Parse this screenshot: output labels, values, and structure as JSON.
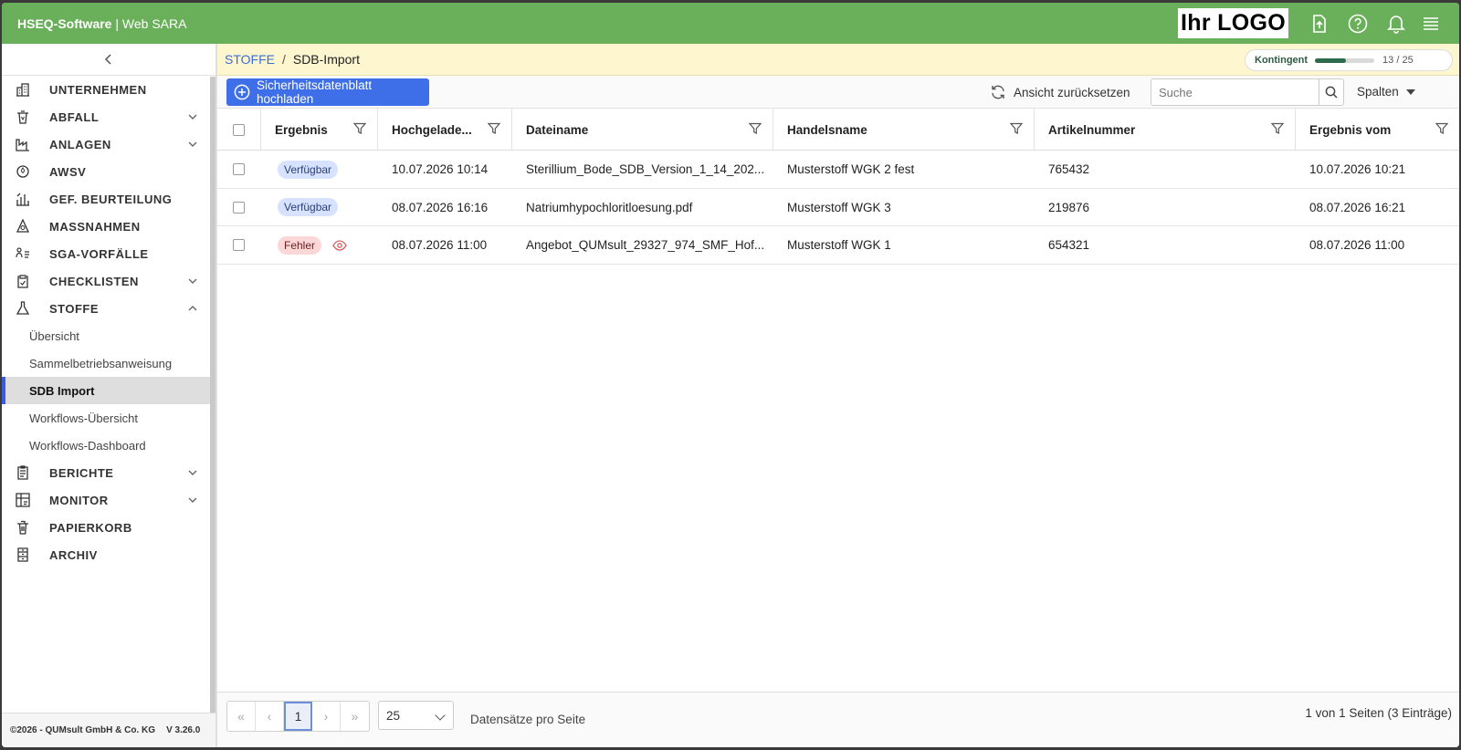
{
  "header": {
    "brand_bold": "HSEQ-Software",
    "brand_sep": " | ",
    "brand_rest": "Web SARA",
    "logo_text": "Ihr LOGO",
    "bg_color": "#6aaf5a"
  },
  "sidebar": {
    "items": [
      {
        "label": "UNTERNEHMEN",
        "icon": "building-icon",
        "expandable": false
      },
      {
        "label": "ABFALL",
        "icon": "waste-bin-icon",
        "expandable": true
      },
      {
        "label": "ANLAGEN",
        "icon": "factory-icon",
        "expandable": true
      },
      {
        "label": "AWSV",
        "icon": "water-drop-icon",
        "expandable": false
      },
      {
        "label": "GEF. BEURTEILUNG",
        "icon": "risk-chart-icon",
        "expandable": false
      },
      {
        "label": "MASSNAHMEN",
        "icon": "measures-icon",
        "expandable": false
      },
      {
        "label": "SGA-VORFÄLLE",
        "icon": "incident-icon",
        "expandable": false
      },
      {
        "label": "CHECKLISTEN",
        "icon": "clipboard-check-icon",
        "expandable": true
      },
      {
        "label": "STOFFE",
        "icon": "flask-icon",
        "expandable": true,
        "expanded": true
      }
    ],
    "sub_items": [
      {
        "label": "Übersicht"
      },
      {
        "label": "Sammelbetriebsanweisung"
      },
      {
        "label": "SDB Import",
        "active": true
      },
      {
        "label": "Workflows-Übersicht"
      },
      {
        "label": "Workflows-Dashboard"
      }
    ],
    "items_after": [
      {
        "label": "BERICHTE",
        "icon": "report-icon",
        "expandable": true
      },
      {
        "label": "MONITOR",
        "icon": "monitor-grid-icon",
        "expandable": true
      },
      {
        "label": "PAPIERKORB",
        "icon": "trash-icon",
        "expandable": false
      },
      {
        "label": "ARCHIV",
        "icon": "archive-icon",
        "expandable": false
      }
    ],
    "footer_copyright": "©2026 - QUMsult GmbH & Co. KG",
    "footer_version": "V 3.26.0"
  },
  "breadcrumb": {
    "parent": "STOFFE",
    "separator": "/",
    "current": "SDB-Import"
  },
  "quota": {
    "label": "Kontingent",
    "text": "13 / 25",
    "used": 13,
    "total": 25
  },
  "toolbar": {
    "upload_label": "Sicherheitsdatenblatt hochladen",
    "reset_label": "Ansicht zurücksetzen",
    "search_placeholder": "Suche",
    "columns_label": "Spalten",
    "accent_color": "#3f6fe8"
  },
  "table": {
    "headers": [
      "Ergebnis",
      "Hochgelade...",
      "Dateiname",
      "Handelsname",
      "Artikelnummer",
      "Ergebnis vom"
    ],
    "rows": [
      {
        "status": "Verfügbar",
        "status_type": "ok",
        "uploaded": "10.07.2026 10:14",
        "filename": "Sterillium_Bode_SDB_Version_1_14_202...",
        "trade_name": "Musterstoff WGK 2 fest",
        "article": "765432",
        "result_date": "10.07.2026 10:21"
      },
      {
        "status": "Verfügbar",
        "status_type": "ok",
        "uploaded": "08.07.2026 16:16",
        "filename": "Natriumhypochloritloesung.pdf",
        "trade_name": "Musterstoff WGK 3",
        "article": "219876",
        "result_date": "08.07.2026 16:21"
      },
      {
        "status": "Fehler",
        "status_type": "err",
        "uploaded": "08.07.2026 11:00",
        "filename": "Angebot_QUMsult_29327_974_SMF_Hof...",
        "trade_name": "Musterstoff WGK 1",
        "article": "654321",
        "result_date": "08.07.2026 11:00"
      }
    ]
  },
  "pager": {
    "first": "«",
    "prev": "‹",
    "current_page": "1",
    "next": "›",
    "last": "»",
    "page_size": "25",
    "page_size_label": "Datensätze pro Seite",
    "info": "1 von 1 Seiten (3 Einträge)"
  }
}
